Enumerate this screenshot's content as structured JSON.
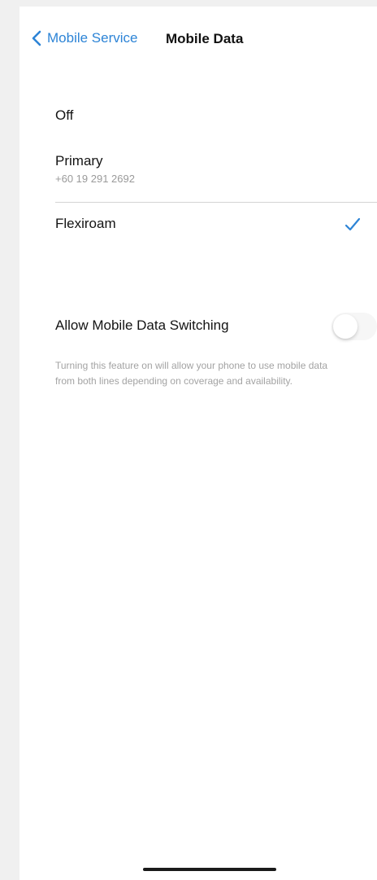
{
  "nav": {
    "back_label": "Mobile Service",
    "title": "Mobile Data"
  },
  "options": {
    "off": {
      "label": "Off"
    },
    "primary": {
      "label": "Primary",
      "number": "+60 19 291 2692"
    },
    "flexiroam": {
      "label": "Flexiroam",
      "selected": true
    }
  },
  "switching": {
    "label": "Allow Mobile Data Switching",
    "enabled": false,
    "description": "Turning this feature on will allow your phone to use mobile data from both lines depending on coverage and availability."
  },
  "colors": {
    "accent": "#2d84d6",
    "text": "#141414",
    "secondary_text": "#9a9a9a"
  },
  "icons": {
    "back": "chevron-left-icon",
    "selected": "checkmark-icon"
  }
}
